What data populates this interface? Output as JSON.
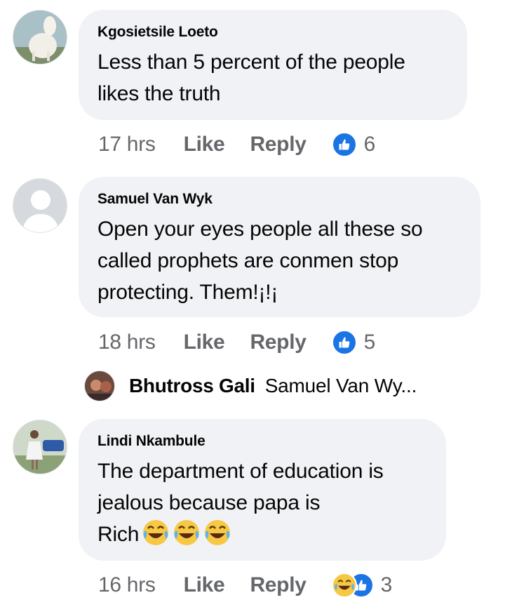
{
  "comments": [
    {
      "author": "Kgosietsile Loeto",
      "text_lines": [
        "Less than 5 percent of the people",
        "likes the truth"
      ],
      "time": "17 hrs",
      "like_label": "Like",
      "reply_label": "Reply",
      "reaction_count": "6",
      "reaction_icon": "like-reaction-icon",
      "avatar_icon": "user-photo-avatar"
    },
    {
      "author": "Samuel Van Wyk",
      "text_lines": [
        "Open your eyes people all these so",
        "called prophets are conmen stop",
        "protecting. Them!¡!¡"
      ],
      "time": "18 hrs",
      "like_label": "Like",
      "reply_label": "Reply",
      "reaction_count": "5",
      "reaction_icon": "like-reaction-icon",
      "avatar_icon": "default-profile-avatar"
    },
    {
      "author": "Lindi Nkambule",
      "text_lines": [
        "The department of education is",
        "jealous because papa is",
        "Rich"
      ],
      "text_emoji": "face-with-tears-of-joy x3",
      "time": "16 hrs",
      "like_label": "Like",
      "reply_label": "Reply",
      "reaction_count": "3",
      "reaction_icon": "haha-and-like-reaction-icons",
      "avatar_icon": "user-photo-avatar"
    }
  ],
  "reply_preview": {
    "author": "Bhutross Gali",
    "text": "Samuel Van Wy...",
    "avatar_icon": "user-photo-avatar"
  },
  "colors": {
    "bubble": "#f0f2f5",
    "text": "#050505",
    "secondary": "#65676b",
    "like_blue": "#1b74e4",
    "haha_yellow": "#f7c844"
  }
}
